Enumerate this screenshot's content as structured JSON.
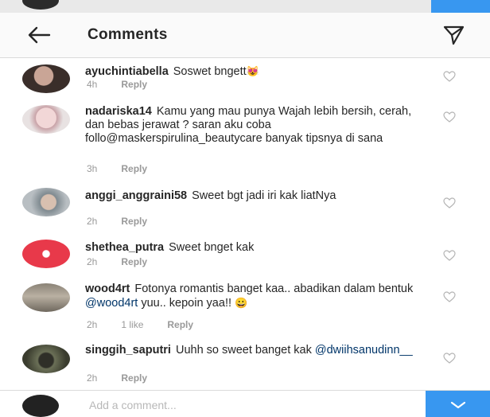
{
  "header": {
    "title": "Comments"
  },
  "comments": [
    {
      "user": "ayuchintiabella",
      "text": "Soswet bngett",
      "emoji": "😻",
      "time": "4h",
      "likes": "",
      "reply": "Reply",
      "avatar_color": "#3a2e2a"
    },
    {
      "user": "nadariska14",
      "text": "Kamu yang mau punya Wajah lebih bersih, cerah, dan bebas jerawat ? saran aku coba follo@maskerspirulina_beautycare banyak tipsnya di sana",
      "time": "3h",
      "likes": "",
      "reply": "Reply",
      "avatar_color": "#d9b7b9"
    },
    {
      "user": "anggi_anggraini58",
      "text": "Sweet bgt jadi iri kak liatNya",
      "time": "2h",
      "likes": "",
      "reply": "Reply",
      "avatar_color": "#9aa3a8"
    },
    {
      "user": "shethea_putra",
      "text": "Sweet bnget kak",
      "time": "2h",
      "likes": "",
      "reply": "Reply",
      "avatar_color": "#e8394a"
    },
    {
      "user": "wood4rt",
      "text_before": "Fotonya romantis banget kaa.. abadikan dalam bentuk ",
      "mention": "@wood4rt",
      "text_after": " yuu.. kepoin yaa!!",
      "emoji": "😀",
      "time": "2h",
      "likes": "1 like",
      "reply": "Reply",
      "avatar_color": "#8a8276"
    },
    {
      "user": "singgih_saputri",
      "text_before": "Uuhh so sweet banget kak ",
      "mention": "@dwiihsanudinn__",
      "text_after": "",
      "time": "2h",
      "likes": "",
      "reply": "Reply",
      "avatar_color": "#4d4f3f"
    }
  ],
  "composer": {
    "placeholder": "Add a comment..."
  },
  "colors": {
    "accent": "#3897f0",
    "text": "#262626",
    "muted": "#999999",
    "mention": "#003569"
  },
  "icons": {
    "back": "arrow-left-icon",
    "send": "paper-plane-icon",
    "like": "heart-icon",
    "post": "check-icon"
  }
}
